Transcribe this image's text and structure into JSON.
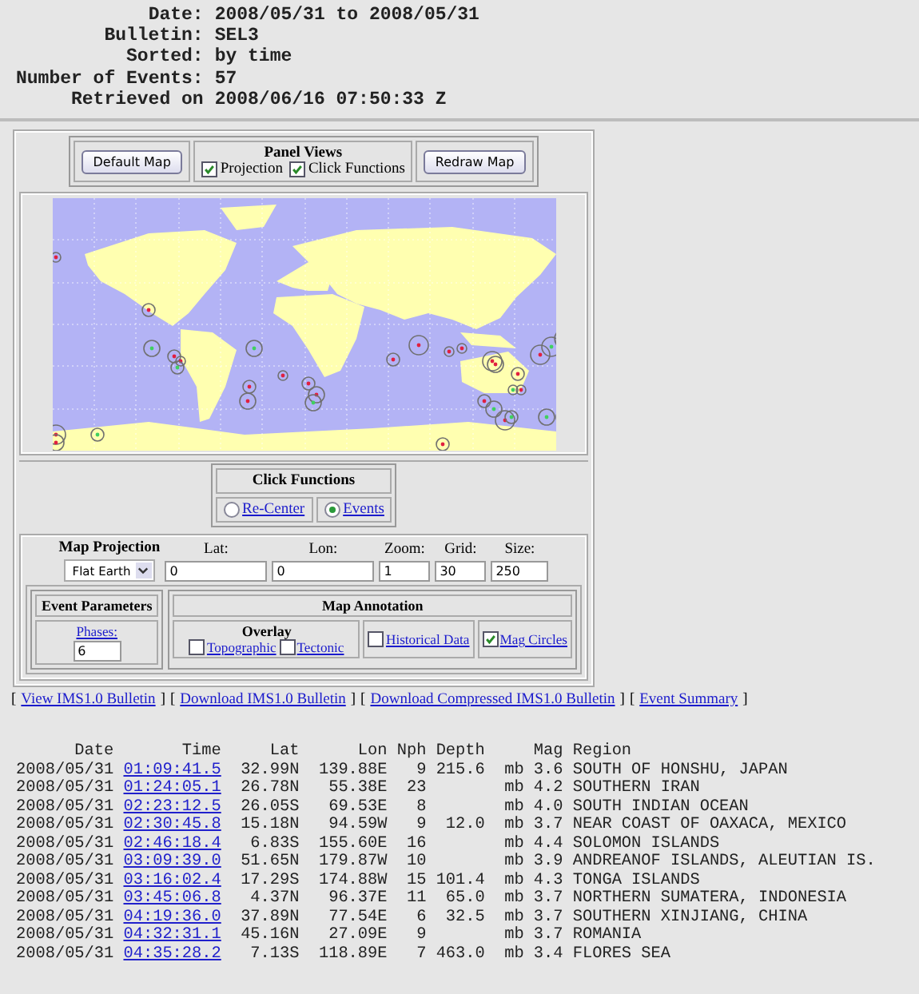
{
  "header": [
    {
      "label": "Date:",
      "value": "2008/05/31 to 2008/05/31"
    },
    {
      "label": "Bulletin:",
      "value": "SEL3"
    },
    {
      "label": "Sorted:",
      "value": "by time"
    },
    {
      "label": "Number of Events:",
      "value": "57"
    },
    {
      "label": "Retrieved on",
      "value": "2008/06/16 07:50:33 Z"
    }
  ],
  "panel": {
    "default_button": "Default Map",
    "redraw_button": "Redraw Map",
    "panel_views": {
      "title": "Panel Views",
      "options": [
        {
          "label": "Projection",
          "checked": true
        },
        {
          "label": "Click Functions",
          "checked": true
        }
      ]
    },
    "click_functions": {
      "title": "Click Functions",
      "options": [
        {
          "label": "Re-Center",
          "selected": false
        },
        {
          "label": "Events",
          "selected": true
        }
      ]
    },
    "projection": {
      "label": "Map Projection",
      "select": "Flat Earth",
      "fields": [
        {
          "label": "Lat:",
          "value": "0"
        },
        {
          "label": "Lon:",
          "value": "0"
        },
        {
          "label": "Zoom:",
          "value": "1"
        },
        {
          "label": "Grid:",
          "value": "30"
        },
        {
          "label": "Size:",
          "value": "250"
        }
      ]
    },
    "event_parameters": {
      "title": "Event Parameters",
      "link": "Phases:",
      "value": "6"
    },
    "map_annotation": {
      "title": "Map Annotation",
      "overlay_title": "Overlay",
      "overlay": [
        {
          "label": "Topographic",
          "checked": false
        },
        {
          "label": "Tectonic",
          "checked": false
        }
      ],
      "others": [
        {
          "label": "Historical Data",
          "checked": false
        },
        {
          "label": "Mag Circles",
          "checked": true
        }
      ]
    }
  },
  "links": [
    {
      "open": "[",
      "label": "View IMS1.0 Bulletin",
      "close": "]"
    },
    {
      "open": "[",
      "label": "Download IMS1.0 Bulletin",
      "close": "]"
    },
    {
      "open": "[",
      "label": "Download Compressed IMS1.0 Bulletin",
      "close": "]"
    },
    {
      "open": "[",
      "label": "Event Summary",
      "close": "]"
    }
  ],
  "table": {
    "columns": [
      "Date",
      "Time",
      "Lat",
      "Lon",
      "Nph",
      "Depth",
      "Mag",
      "Region"
    ],
    "rows": [
      {
        "date": "2008/05/31",
        "time": "01:09:41.5",
        "lat": "32.99N",
        "lon": "139.88E",
        "nph": "9",
        "depth": "215.6",
        "mag_type": "mb",
        "mag": "3.6",
        "region": "SOUTH OF HONSHU, JAPAN"
      },
      {
        "date": "2008/05/31",
        "time": "01:24:05.1",
        "lat": "26.78N",
        "lon": "55.38E",
        "nph": "23",
        "depth": "",
        "mag_type": "mb",
        "mag": "4.2",
        "region": "SOUTHERN IRAN"
      },
      {
        "date": "2008/05/31",
        "time": "02:23:12.5",
        "lat": "26.05S",
        "lon": "69.53E",
        "nph": "8",
        "depth": "",
        "mag_type": "mb",
        "mag": "4.0",
        "region": "SOUTH INDIAN OCEAN"
      },
      {
        "date": "2008/05/31",
        "time": "02:30:45.8",
        "lat": "15.18N",
        "lon": "94.59W",
        "nph": "9",
        "depth": "12.0",
        "mag_type": "mb",
        "mag": "3.7",
        "region": "NEAR COAST OF OAXACA, MEXICO"
      },
      {
        "date": "2008/05/31",
        "time": "02:46:18.4",
        "lat": "6.83S",
        "lon": "155.60E",
        "nph": "16",
        "depth": "",
        "mag_type": "mb",
        "mag": "4.4",
        "region": "SOLOMON ISLANDS"
      },
      {
        "date": "2008/05/31",
        "time": "03:09:39.0",
        "lat": "51.65N",
        "lon": "179.87W",
        "nph": "10",
        "depth": "",
        "mag_type": "mb",
        "mag": "3.9",
        "region": "ANDREANOF ISLANDS, ALEUTIAN IS."
      },
      {
        "date": "2008/05/31",
        "time": "03:16:02.4",
        "lat": "17.29S",
        "lon": "174.88W",
        "nph": "15",
        "depth": "101.4",
        "mag_type": "mb",
        "mag": "4.3",
        "region": "TONGA ISLANDS"
      },
      {
        "date": "2008/05/31",
        "time": "03:45:06.8",
        "lat": "4.37N",
        "lon": "96.37E",
        "nph": "11",
        "depth": "65.0",
        "mag_type": "mb",
        "mag": "3.7",
        "region": "NORTHERN SUMATERA, INDONESIA"
      },
      {
        "date": "2008/05/31",
        "time": "04:19:36.0",
        "lat": "37.89N",
        "lon": "77.54E",
        "nph": "6",
        "depth": "32.5",
        "mag_type": "mb",
        "mag": "3.7",
        "region": "SOUTHERN XINJIANG, CHINA"
      },
      {
        "date": "2008/05/31",
        "time": "04:32:31.1",
        "lat": "45.16N",
        "lon": "27.09E",
        "nph": "9",
        "depth": "",
        "mag_type": "mb",
        "mag": "3.7",
        "region": "ROMANIA"
      },
      {
        "date": "2008/05/31",
        "time": "04:35:28.2",
        "lat": "7.13S",
        "lon": "118.89E",
        "nph": "7",
        "depth": "463.0",
        "mag_type": "mb",
        "mag": "3.4",
        "region": "FLORES SEA"
      }
    ]
  }
}
